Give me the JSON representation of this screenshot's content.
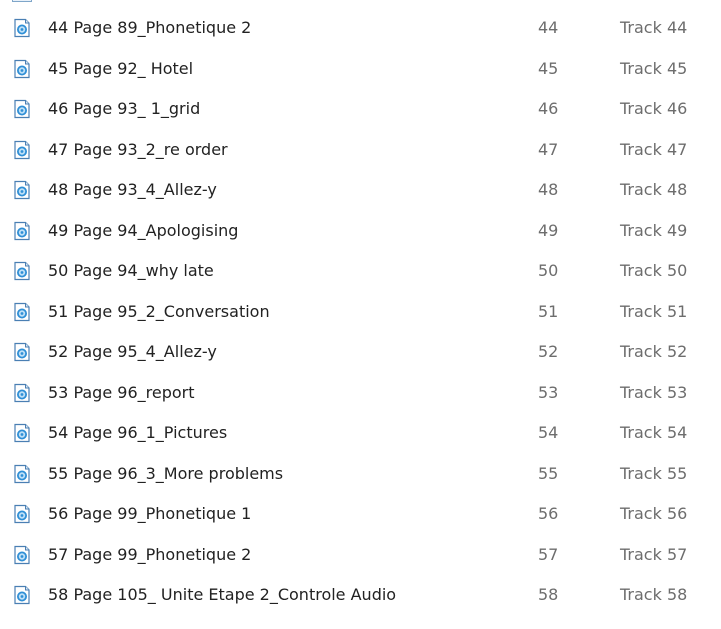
{
  "colors": {
    "text_primary": "#222222",
    "text_secondary": "#6d6d6d",
    "icon_border": "#4a7fb3",
    "icon_disc": "#2f8fd6"
  },
  "file_icon": "audio-file-icon",
  "files": [
    {
      "name": "44 Page 89_Phonetique 2",
      "number": "44",
      "title": "Track 44"
    },
    {
      "name": "45 Page 92_ Hotel",
      "number": "45",
      "title": "Track 45"
    },
    {
      "name": "46 Page 93_ 1_grid",
      "number": "46",
      "title": "Track 46"
    },
    {
      "name": "47 Page 93_2_re order",
      "number": "47",
      "title": "Track 47"
    },
    {
      "name": "48 Page 93_4_Allez-y",
      "number": "48",
      "title": "Track 48"
    },
    {
      "name": "49 Page 94_Apologising",
      "number": "49",
      "title": "Track 49"
    },
    {
      "name": "50 Page 94_why late",
      "number": "50",
      "title": "Track 50"
    },
    {
      "name": "51 Page 95_2_Conversation",
      "number": "51",
      "title": "Track 51"
    },
    {
      "name": "52 Page 95_4_Allez-y",
      "number": "52",
      "title": "Track 52"
    },
    {
      "name": "53 Page 96_report",
      "number": "53",
      "title": "Track 53"
    },
    {
      "name": "54 Page 96_1_Pictures",
      "number": "54",
      "title": "Track 54"
    },
    {
      "name": "55 Page 96_3_More problems",
      "number": "55",
      "title": "Track 55"
    },
    {
      "name": "56 Page 99_Phonetique 1",
      "number": "56",
      "title": "Track 56"
    },
    {
      "name": "57 Page 99_Phonetique 2",
      "number": "57",
      "title": "Track 57"
    },
    {
      "name": "58 Page 105_ Unite Etape 2_Controle Audio",
      "number": "58",
      "title": "Track 58"
    }
  ]
}
